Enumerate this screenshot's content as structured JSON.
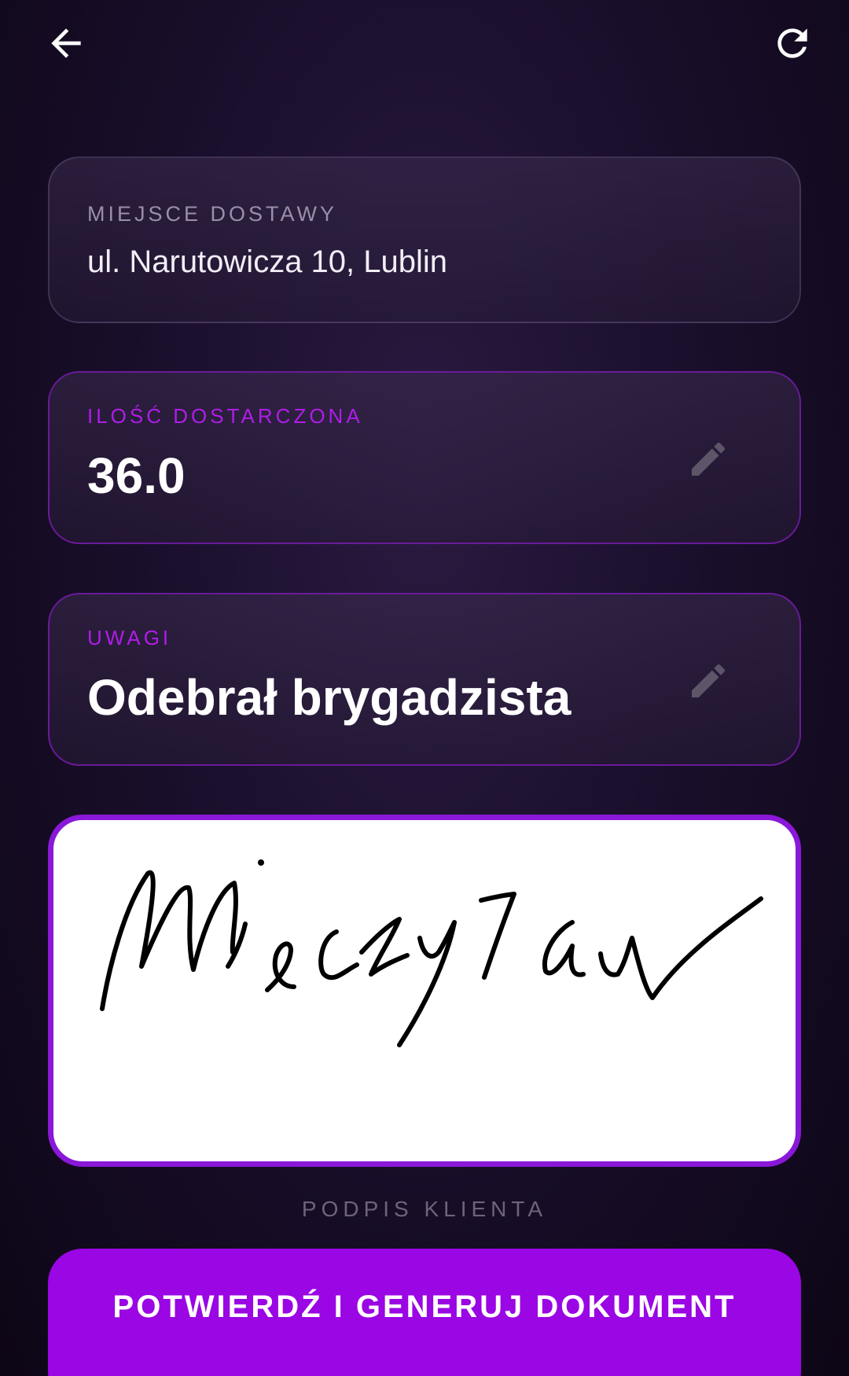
{
  "topbar": {
    "back_icon": "arrow-left-icon",
    "refresh_icon": "refresh-icon"
  },
  "location": {
    "label": "MIEJSCE DOSTAWY",
    "value": "ul. Narutowicza 10, Lublin"
  },
  "quantity": {
    "label": "ILOŚĆ DOSTARCZONA",
    "value": "36.0",
    "edit_icon": "pencil-icon"
  },
  "notes": {
    "label": "UWAGI",
    "value": "Odebrał brygadzista",
    "edit_icon": "pencil-icon"
  },
  "signature": {
    "caption": "PODPIS KLIENTA",
    "handwriting": "Mieczysław"
  },
  "actions": {
    "confirm_label": "POTWIERDŹ I GENERUJ DOKUMENT"
  },
  "colors": {
    "accent": "#9a06e4",
    "label_accent": "#b01ce8",
    "signature_border": "#8a18d8"
  }
}
